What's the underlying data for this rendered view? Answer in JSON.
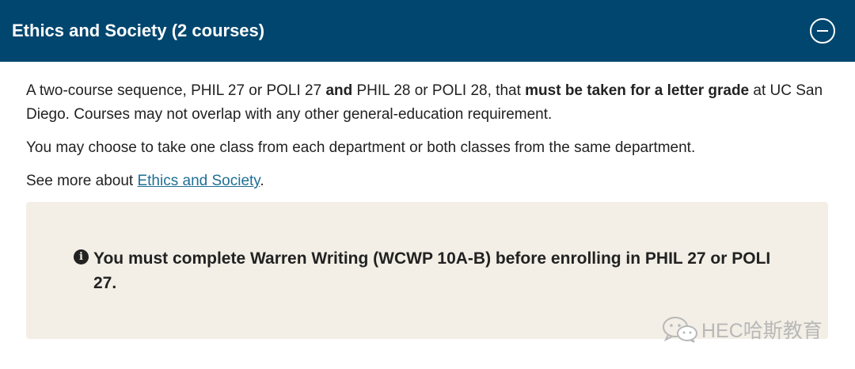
{
  "accordion": {
    "title": "Ethics and Society (2 courses)",
    "collapse_icon": "minus-circle-icon"
  },
  "body": {
    "p1_a": "A two-course sequence, PHIL 27 or POLI 27 ",
    "p1_b": "and",
    "p1_c": " PHIL 28 or POLI 28, that ",
    "p1_d": "must be taken for a letter grade",
    "p1_e": " at UC San Diego. Courses may not overlap with any other general-education requirement.",
    "p2": "You may choose to take one class from each department or both classes from the same department.",
    "p3_prefix": "See more about ",
    "p3_link": "Ethics and Society",
    "p3_suffix": "."
  },
  "notice": {
    "icon": "info-icon",
    "icon_glyph": "i",
    "text": "You must complete Warren Writing (WCWP 10A-B) before enrolling in PHIL 27 or POLI 27."
  },
  "watermark": {
    "icon": "wechat-icon",
    "text": "HEC哈斯教育"
  },
  "colors": {
    "header_bg": "#00466e",
    "notice_bg": "#f3efe6",
    "link": "#1f6f93"
  }
}
